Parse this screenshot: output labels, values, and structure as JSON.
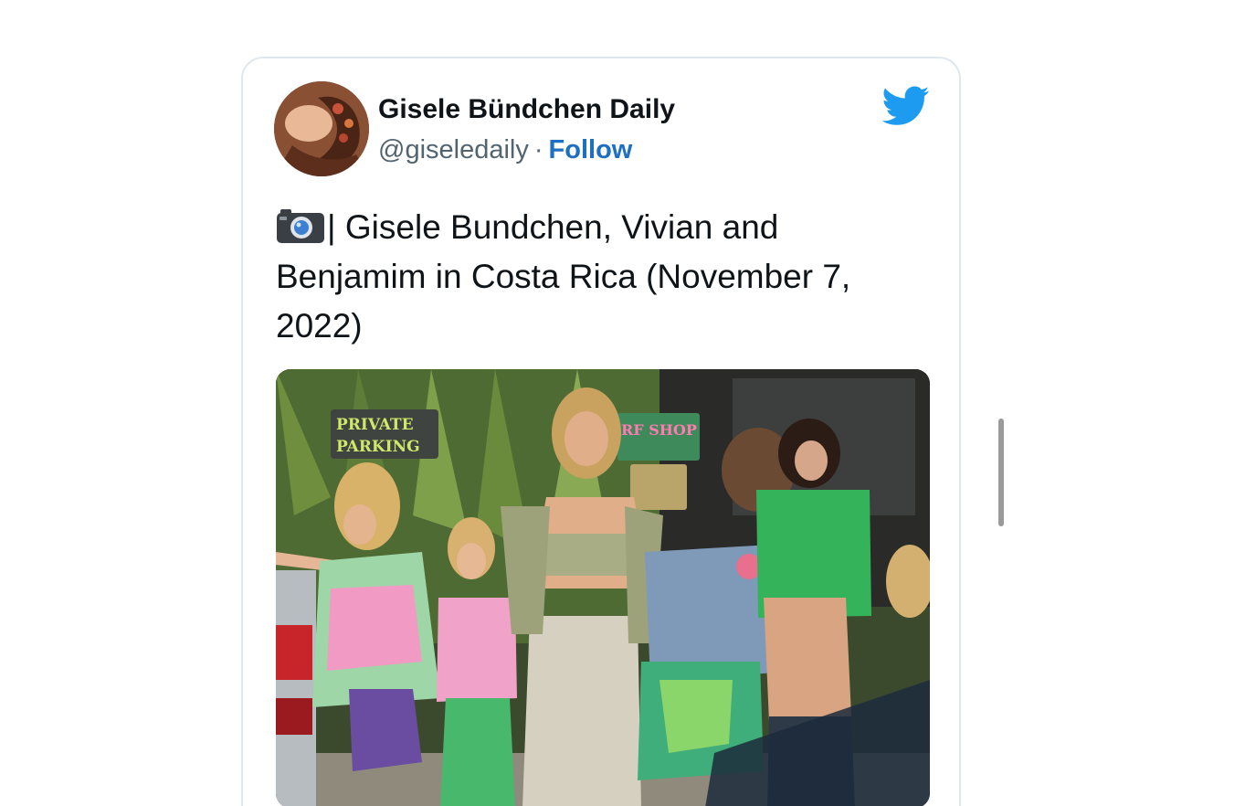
{
  "tweet": {
    "author": {
      "display_name": "Gisele Bündchen Daily",
      "handle": "@giseledaily",
      "separator": "·",
      "follow_label": "Follow"
    },
    "text": "| Gisele Bundchen, Vivian and Benjamim in Costa Rica (November 7, 2022)",
    "text_prefix_icon": "camera-icon",
    "brand_icon": "twitter-bird-icon",
    "media": {
      "sign_private": "PRIVATE",
      "sign_parking": "PARKING",
      "sign_shop": "RF SHOP"
    }
  },
  "colors": {
    "brand_blue": "#1d9bf0",
    "follow_blue": "#1d6fc2",
    "text": "#0f1419",
    "muted": "#536471",
    "card_border": "#e1e8ed"
  }
}
